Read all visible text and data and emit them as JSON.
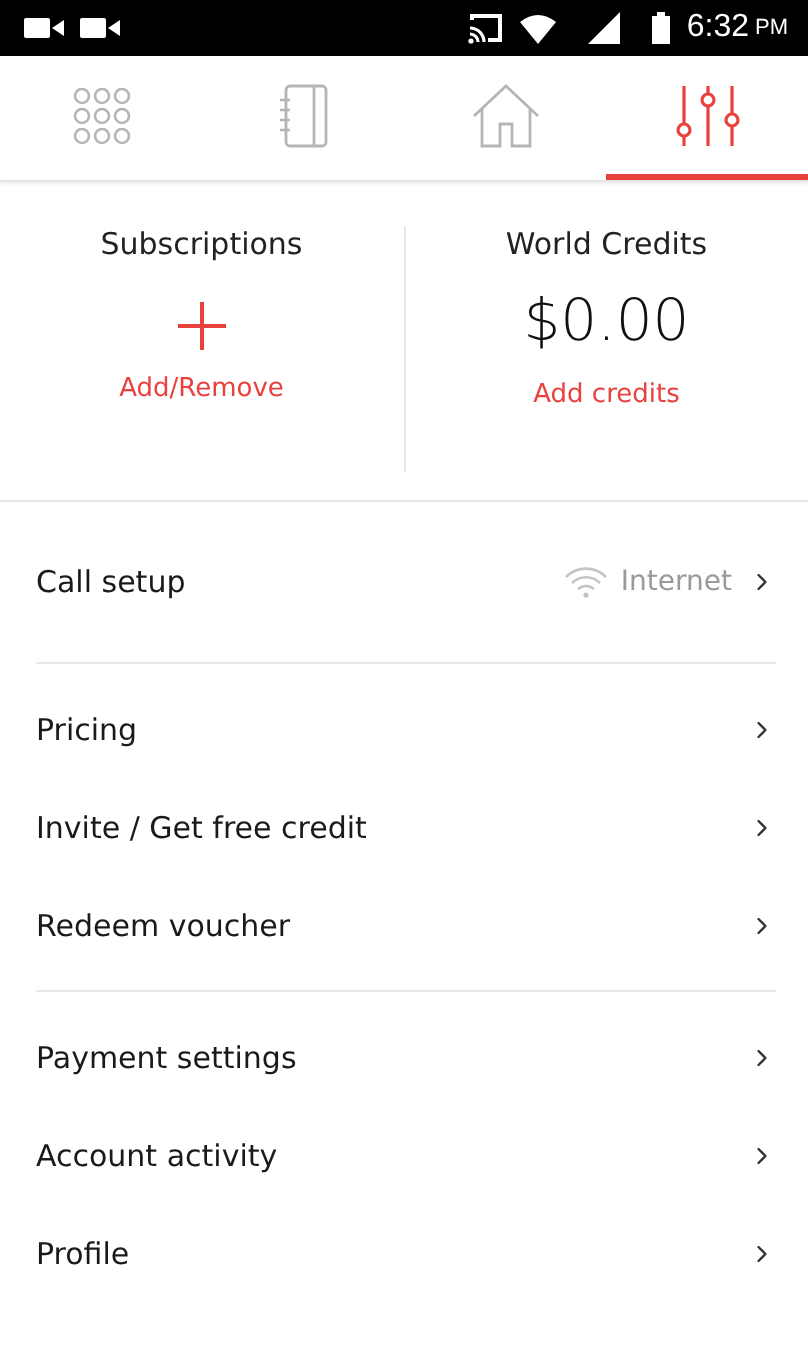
{
  "status_bar": {
    "time": "6:32",
    "period": "PM"
  },
  "tabs": [
    {
      "kind": "dialpad",
      "selected": false
    },
    {
      "kind": "contacts",
      "selected": false
    },
    {
      "kind": "home",
      "selected": false
    },
    {
      "kind": "settings",
      "selected": true
    }
  ],
  "summary": {
    "subscriptions": {
      "title": "Subscriptions",
      "action": "Add/Remove"
    },
    "credits": {
      "title": "World Credits",
      "amount": "$0.00",
      "action": "Add credits"
    }
  },
  "sections": [
    [
      {
        "label": "Call setup",
        "value": "Internet",
        "kind": "wifi"
      }
    ],
    [
      {
        "label": "Pricing"
      },
      {
        "label": "Invite / Get free credit"
      },
      {
        "label": "Redeem voucher"
      }
    ],
    [
      {
        "label": "Payment settings"
      },
      {
        "label": "Account activity"
      },
      {
        "label": "Profile"
      }
    ]
  ]
}
